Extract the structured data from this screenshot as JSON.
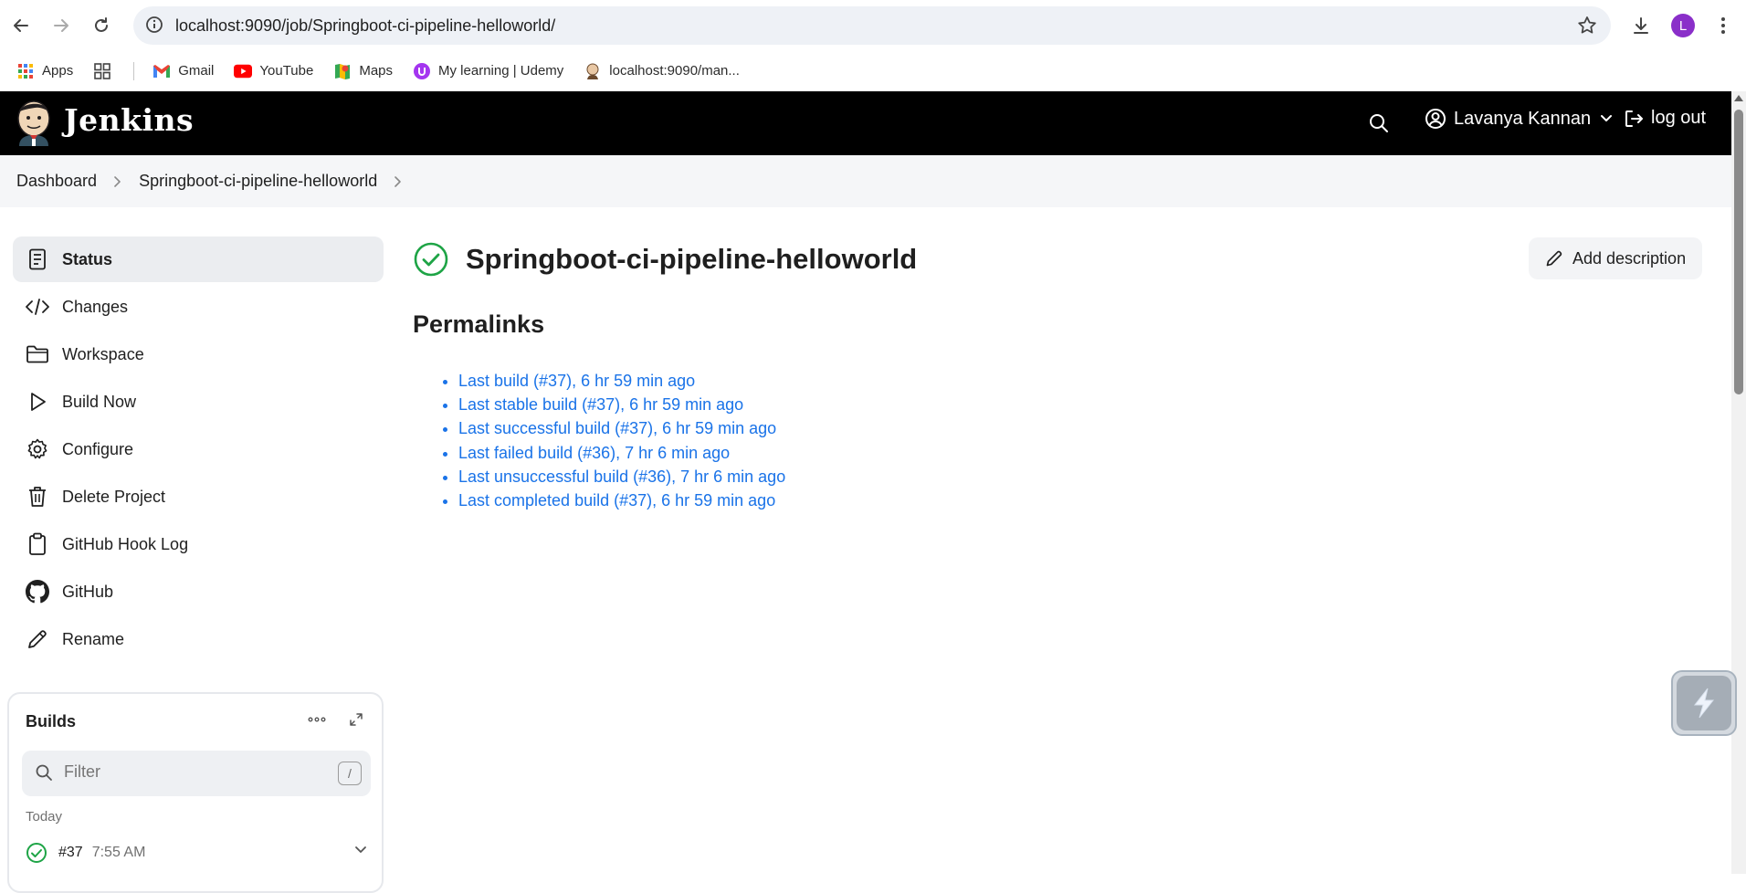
{
  "browser": {
    "url": "localhost:9090/job/Springboot-ci-pipeline-helloworld/",
    "profile_initial": "L",
    "bookmarks": [
      {
        "label": "Apps"
      },
      {
        "label": ""
      },
      {
        "label": "Gmail"
      },
      {
        "label": "YouTube"
      },
      {
        "label": "Maps"
      },
      {
        "label": "My learning | Udemy"
      },
      {
        "label": "localhost:9090/man..."
      }
    ]
  },
  "header": {
    "app_name": "Jenkins",
    "user_name": "Lavanya Kannan",
    "logout_label": "log out"
  },
  "breadcrumb": {
    "items": [
      "Dashboard",
      "Springboot-ci-pipeline-helloworld"
    ]
  },
  "sidebar": {
    "items": [
      {
        "label": "Status",
        "icon": "document-icon"
      },
      {
        "label": "Changes",
        "icon": "code-icon"
      },
      {
        "label": "Workspace",
        "icon": "folder-icon"
      },
      {
        "label": "Build Now",
        "icon": "play-icon"
      },
      {
        "label": "Configure",
        "icon": "gear-icon"
      },
      {
        "label": "Delete Project",
        "icon": "trash-icon"
      },
      {
        "label": "GitHub Hook Log",
        "icon": "clipboard-icon"
      },
      {
        "label": "GitHub",
        "icon": "github-icon"
      },
      {
        "label": "Rename",
        "icon": "pencil-icon"
      }
    ]
  },
  "builds": {
    "title": "Builds",
    "filter_placeholder": "Filter",
    "filter_shortcut": "/",
    "group_label": "Today",
    "rows": [
      {
        "number": "#37",
        "time": "7:55 AM",
        "status": "success"
      }
    ]
  },
  "main": {
    "job_title": "Springboot-ci-pipeline-helloworld",
    "add_description_label": "Add description",
    "permalinks_title": "Permalinks",
    "permalinks": [
      "Last build (#37), 6 hr 59 min ago",
      "Last stable build (#37), 6 hr 59 min ago",
      "Last successful build (#37), 6 hr 59 min ago",
      "Last failed build (#36), 7 hr 6 min ago",
      "Last unsuccessful build (#36), 7 hr 6 min ago",
      "Last completed build (#37), 6 hr 59 min ago"
    ]
  },
  "colors": {
    "link": "#1a73e8",
    "success": "#1ea446",
    "header_bg": "#000000"
  }
}
